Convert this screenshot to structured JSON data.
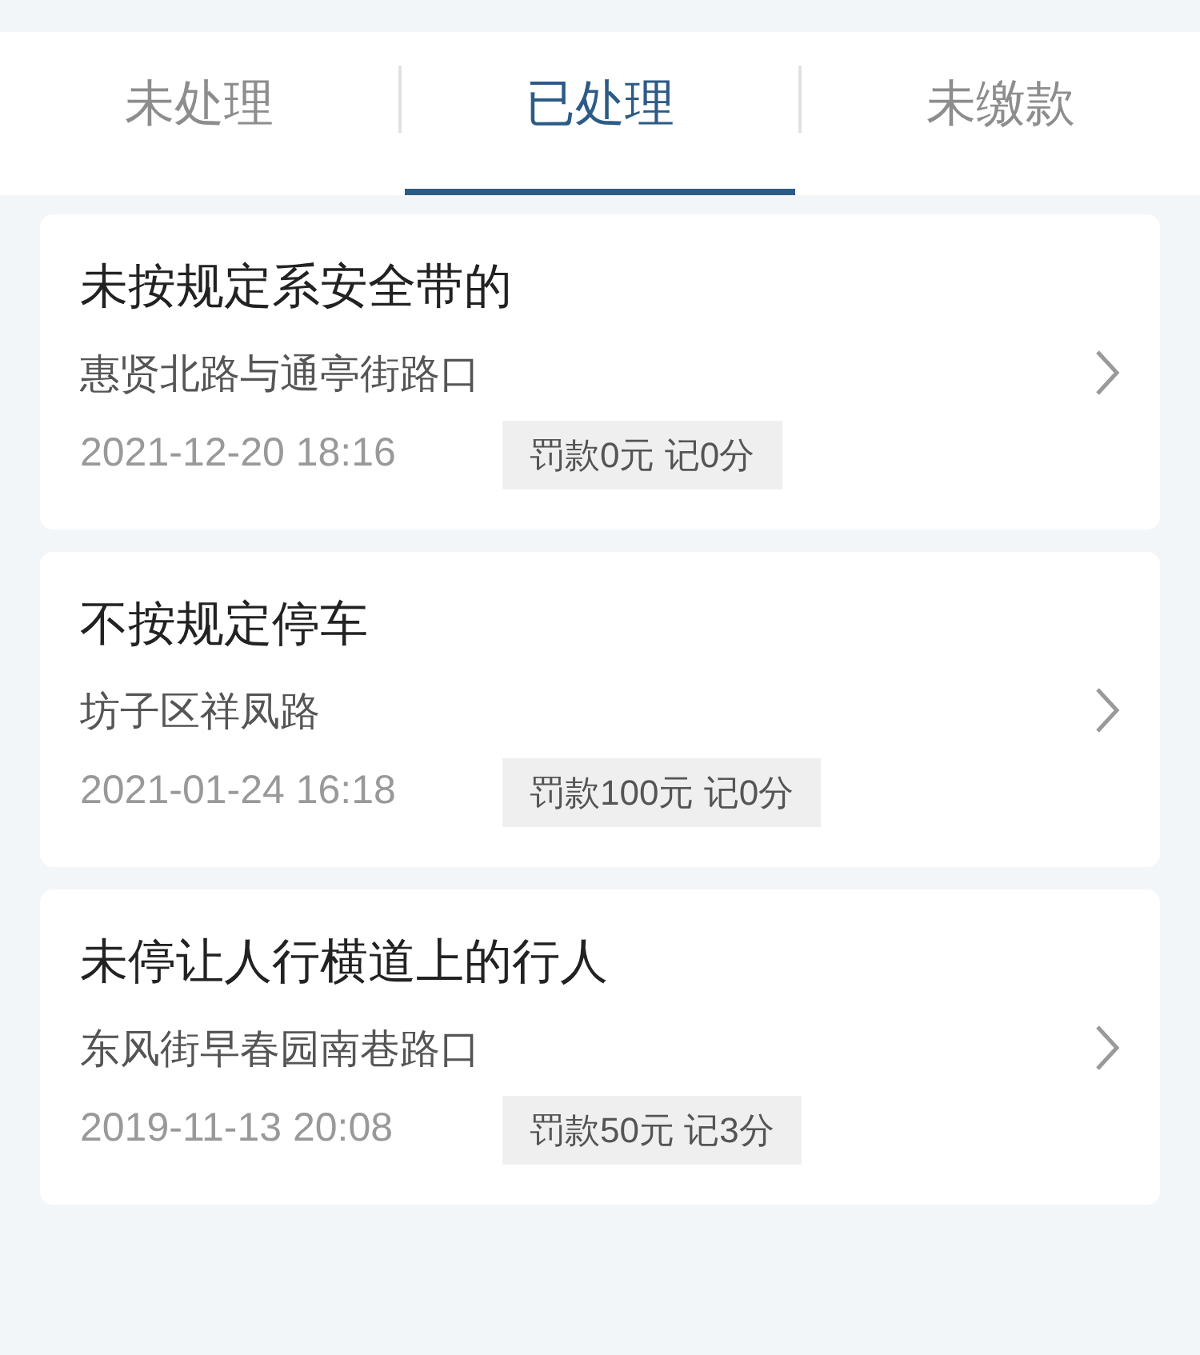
{
  "tabs": [
    {
      "label": "未处理",
      "selected": false
    },
    {
      "label": "已处理",
      "selected": true
    },
    {
      "label": "未缴款",
      "selected": false
    }
  ],
  "records": [
    {
      "title": "未按规定系安全带的",
      "location": "惠贤北路与通亭街路口",
      "time": "2021-12-20 18:16",
      "penalty": "罚款0元 记0分"
    },
    {
      "title": "不按规定停车",
      "location": "坊子区祥凤路",
      "time": "2021-01-24 16:18",
      "penalty": "罚款100元 记0分"
    },
    {
      "title": "未停让人行横道上的行人",
      "location": "东风街早春园南巷路口",
      "time": "2019-11-13 20:08",
      "penalty": "罚款50元 记3分"
    }
  ]
}
